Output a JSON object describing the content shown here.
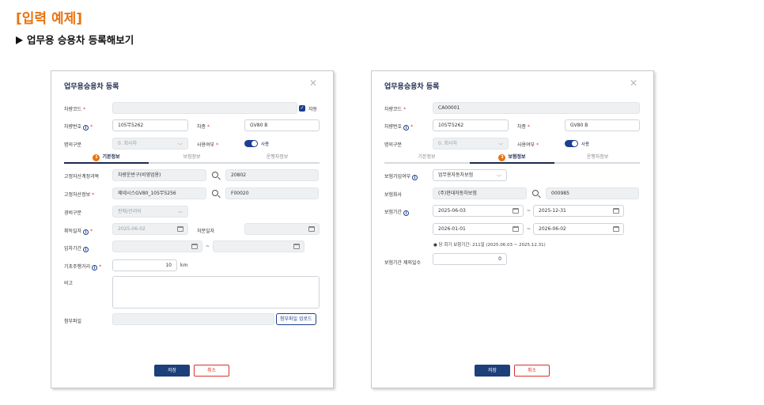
{
  "header": {
    "title": "[입력 예제]",
    "subtitle": "업무용 승용차 등록해보기"
  },
  "dialog1": {
    "title": "업무용승용차 등록",
    "close": "✕",
    "car_code_label": "차량코드",
    "car_code_value": "",
    "auto_label": "자동",
    "car_number_label": "차량번호",
    "car_number_value": "105무5262",
    "car_model_label": "차종",
    "car_model_value": "GV80 B",
    "owner_type_label": "명의구분",
    "owner_type_value": "0. 회사차",
    "use_label": "사용여부",
    "use_value": "사용",
    "tabs": [
      {
        "label": "기본정보",
        "badge": "1"
      },
      {
        "label": "보험정보",
        "badge": ""
      },
      {
        "label": "운행자정보",
        "badge": ""
      }
    ],
    "asset_account_label": "고정자산계정과목",
    "asset_account_value": "차량운반구(비영업용)",
    "asset_account_code": "20802",
    "asset_info_label": "고정자산정보",
    "asset_info_value": "제네시스GV80_105무5256",
    "asset_info_code": "F00020",
    "expense_type_label": "경비구분",
    "expense_type_value": "판매/관리비",
    "acquire_date_label": "취득일자",
    "acquire_date_value": "2025-06-02",
    "dispose_date_label": "처분일자",
    "dispose_date_value": "",
    "lease_period_label": "임차기간",
    "lease_sep": "~",
    "base_mileage_label": "기초주행거리",
    "base_mileage_value": "10",
    "base_mileage_unit": "km",
    "note_label": "비고",
    "attach_label": "첨부파일",
    "upload_button": "첨부파일 업로드",
    "save": "저장",
    "cancel": "취소"
  },
  "dialog2": {
    "title": "업무용승용차 등록",
    "close": "✕",
    "car_code_label": "차량코드",
    "car_code_value": "CA00001",
    "car_number_label": "차량번호",
    "car_number_value": "105무5262",
    "car_model_label": "차종",
    "car_model_value": "GV80 B",
    "owner_type_label": "명의구분",
    "owner_type_value": "0. 회사차",
    "use_label": "사용여부",
    "use_value": "사용",
    "tabs": [
      {
        "label": "기본정보",
        "badge": ""
      },
      {
        "label": "보험정보",
        "badge": "3"
      },
      {
        "label": "운행자정보",
        "badge": ""
      }
    ],
    "insured_label": "보험가입여부",
    "insured_value": "업무용자동차보험",
    "insurer_label": "보험회사",
    "insurer_value": "(주)현대자동차보험",
    "insurer_code": "000985",
    "period_label": "보험기간",
    "period1_start": "2025-06-03",
    "period1_end": "2025-12-31",
    "period2_start": "2026-01-01",
    "period2_end": "2026-06-02",
    "period_sep": "~",
    "period_note": "● 당 회기 보험기간: 211일 (2025.06.03 ~ 2025.12.31)",
    "excluded_days_label": "보험기간 제외일수",
    "excluded_days_value": "0",
    "save": "저장",
    "cancel": "취소"
  }
}
